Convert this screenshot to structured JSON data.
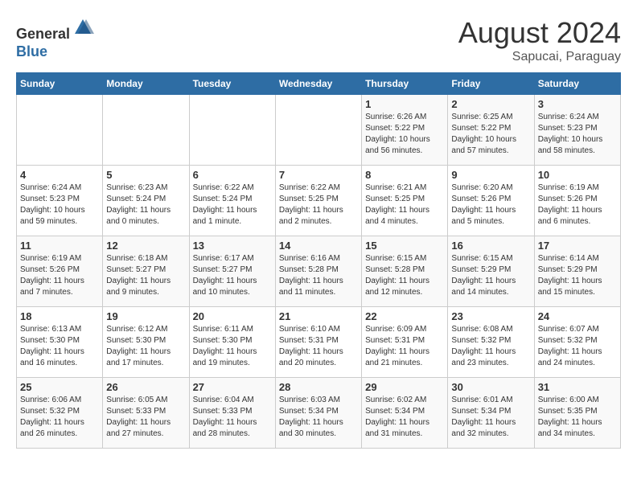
{
  "header": {
    "logo_line1": "General",
    "logo_line2": "Blue",
    "month_year": "August 2024",
    "location": "Sapucai, Paraguay"
  },
  "days_of_week": [
    "Sunday",
    "Monday",
    "Tuesday",
    "Wednesday",
    "Thursday",
    "Friday",
    "Saturday"
  ],
  "weeks": [
    [
      {
        "day": "",
        "sunrise": "",
        "sunset": "",
        "daylight": ""
      },
      {
        "day": "",
        "sunrise": "",
        "sunset": "",
        "daylight": ""
      },
      {
        "day": "",
        "sunrise": "",
        "sunset": "",
        "daylight": ""
      },
      {
        "day": "",
        "sunrise": "",
        "sunset": "",
        "daylight": ""
      },
      {
        "day": "1",
        "sunrise": "Sunrise: 6:26 AM",
        "sunset": "Sunset: 5:22 PM",
        "daylight": "Daylight: 10 hours and 56 minutes."
      },
      {
        "day": "2",
        "sunrise": "Sunrise: 6:25 AM",
        "sunset": "Sunset: 5:22 PM",
        "daylight": "Daylight: 10 hours and 57 minutes."
      },
      {
        "day": "3",
        "sunrise": "Sunrise: 6:24 AM",
        "sunset": "Sunset: 5:23 PM",
        "daylight": "Daylight: 10 hours and 58 minutes."
      }
    ],
    [
      {
        "day": "4",
        "sunrise": "Sunrise: 6:24 AM",
        "sunset": "Sunset: 5:23 PM",
        "daylight": "Daylight: 10 hours and 59 minutes."
      },
      {
        "day": "5",
        "sunrise": "Sunrise: 6:23 AM",
        "sunset": "Sunset: 5:24 PM",
        "daylight": "Daylight: 11 hours and 0 minutes."
      },
      {
        "day": "6",
        "sunrise": "Sunrise: 6:22 AM",
        "sunset": "Sunset: 5:24 PM",
        "daylight": "Daylight: 11 hours and 1 minute."
      },
      {
        "day": "7",
        "sunrise": "Sunrise: 6:22 AM",
        "sunset": "Sunset: 5:25 PM",
        "daylight": "Daylight: 11 hours and 2 minutes."
      },
      {
        "day": "8",
        "sunrise": "Sunrise: 6:21 AM",
        "sunset": "Sunset: 5:25 PM",
        "daylight": "Daylight: 11 hours and 4 minutes."
      },
      {
        "day": "9",
        "sunrise": "Sunrise: 6:20 AM",
        "sunset": "Sunset: 5:26 PM",
        "daylight": "Daylight: 11 hours and 5 minutes."
      },
      {
        "day": "10",
        "sunrise": "Sunrise: 6:19 AM",
        "sunset": "Sunset: 5:26 PM",
        "daylight": "Daylight: 11 hours and 6 minutes."
      }
    ],
    [
      {
        "day": "11",
        "sunrise": "Sunrise: 6:19 AM",
        "sunset": "Sunset: 5:26 PM",
        "daylight": "Daylight: 11 hours and 7 minutes."
      },
      {
        "day": "12",
        "sunrise": "Sunrise: 6:18 AM",
        "sunset": "Sunset: 5:27 PM",
        "daylight": "Daylight: 11 hours and 9 minutes."
      },
      {
        "day": "13",
        "sunrise": "Sunrise: 6:17 AM",
        "sunset": "Sunset: 5:27 PM",
        "daylight": "Daylight: 11 hours and 10 minutes."
      },
      {
        "day": "14",
        "sunrise": "Sunrise: 6:16 AM",
        "sunset": "Sunset: 5:28 PM",
        "daylight": "Daylight: 11 hours and 11 minutes."
      },
      {
        "day": "15",
        "sunrise": "Sunrise: 6:15 AM",
        "sunset": "Sunset: 5:28 PM",
        "daylight": "Daylight: 11 hours and 12 minutes."
      },
      {
        "day": "16",
        "sunrise": "Sunrise: 6:15 AM",
        "sunset": "Sunset: 5:29 PM",
        "daylight": "Daylight: 11 hours and 14 minutes."
      },
      {
        "day": "17",
        "sunrise": "Sunrise: 6:14 AM",
        "sunset": "Sunset: 5:29 PM",
        "daylight": "Daylight: 11 hours and 15 minutes."
      }
    ],
    [
      {
        "day": "18",
        "sunrise": "Sunrise: 6:13 AM",
        "sunset": "Sunset: 5:30 PM",
        "daylight": "Daylight: 11 hours and 16 minutes."
      },
      {
        "day": "19",
        "sunrise": "Sunrise: 6:12 AM",
        "sunset": "Sunset: 5:30 PM",
        "daylight": "Daylight: 11 hours and 17 minutes."
      },
      {
        "day": "20",
        "sunrise": "Sunrise: 6:11 AM",
        "sunset": "Sunset: 5:30 PM",
        "daylight": "Daylight: 11 hours and 19 minutes."
      },
      {
        "day": "21",
        "sunrise": "Sunrise: 6:10 AM",
        "sunset": "Sunset: 5:31 PM",
        "daylight": "Daylight: 11 hours and 20 minutes."
      },
      {
        "day": "22",
        "sunrise": "Sunrise: 6:09 AM",
        "sunset": "Sunset: 5:31 PM",
        "daylight": "Daylight: 11 hours and 21 minutes."
      },
      {
        "day": "23",
        "sunrise": "Sunrise: 6:08 AM",
        "sunset": "Sunset: 5:32 PM",
        "daylight": "Daylight: 11 hours and 23 minutes."
      },
      {
        "day": "24",
        "sunrise": "Sunrise: 6:07 AM",
        "sunset": "Sunset: 5:32 PM",
        "daylight": "Daylight: 11 hours and 24 minutes."
      }
    ],
    [
      {
        "day": "25",
        "sunrise": "Sunrise: 6:06 AM",
        "sunset": "Sunset: 5:32 PM",
        "daylight": "Daylight: 11 hours and 26 minutes."
      },
      {
        "day": "26",
        "sunrise": "Sunrise: 6:05 AM",
        "sunset": "Sunset: 5:33 PM",
        "daylight": "Daylight: 11 hours and 27 minutes."
      },
      {
        "day": "27",
        "sunrise": "Sunrise: 6:04 AM",
        "sunset": "Sunset: 5:33 PM",
        "daylight": "Daylight: 11 hours and 28 minutes."
      },
      {
        "day": "28",
        "sunrise": "Sunrise: 6:03 AM",
        "sunset": "Sunset: 5:34 PM",
        "daylight": "Daylight: 11 hours and 30 minutes."
      },
      {
        "day": "29",
        "sunrise": "Sunrise: 6:02 AM",
        "sunset": "Sunset: 5:34 PM",
        "daylight": "Daylight: 11 hours and 31 minutes."
      },
      {
        "day": "30",
        "sunrise": "Sunrise: 6:01 AM",
        "sunset": "Sunset: 5:34 PM",
        "daylight": "Daylight: 11 hours and 32 minutes."
      },
      {
        "day": "31",
        "sunrise": "Sunrise: 6:00 AM",
        "sunset": "Sunset: 5:35 PM",
        "daylight": "Daylight: 11 hours and 34 minutes."
      }
    ]
  ]
}
